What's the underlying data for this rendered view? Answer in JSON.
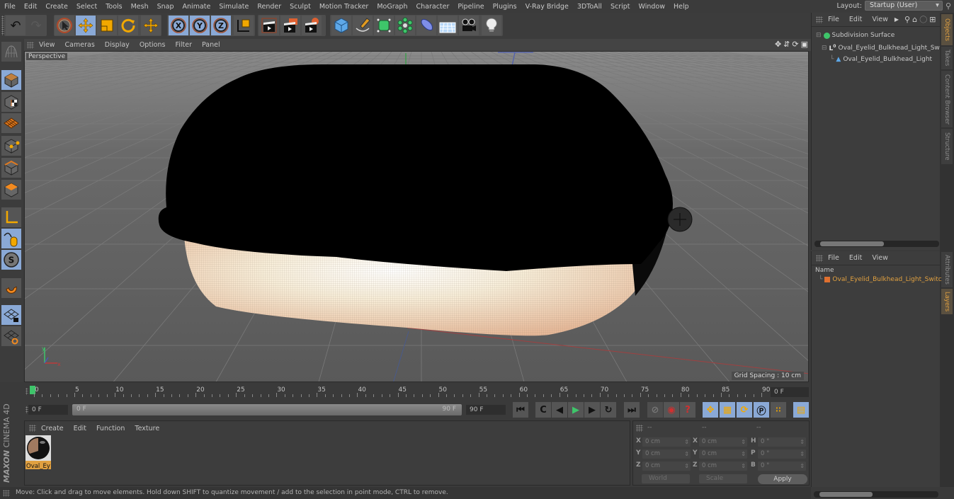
{
  "app": {
    "name": "CINEMA 4D",
    "brand": "MAXON"
  },
  "menubar": {
    "items": [
      "File",
      "Edit",
      "Create",
      "Select",
      "Tools",
      "Mesh",
      "Snap",
      "Animate",
      "Simulate",
      "Render",
      "Sculpt",
      "Motion Tracker",
      "MoGraph",
      "Character",
      "Pipeline",
      "Plugins",
      "V-Ray Bridge",
      "3DToAll",
      "Script",
      "Window",
      "Help"
    ],
    "layout_label": "Layout:",
    "layout_value": "Startup (User)"
  },
  "toolbar": {
    "buttons": [
      {
        "name": "undo-icon",
        "active": false
      },
      {
        "name": "redo-icon",
        "active": false
      },
      {
        "name": "live-selection-icon",
        "active": false
      },
      {
        "name": "move-icon",
        "active": true
      },
      {
        "name": "scale-icon",
        "active": false
      },
      {
        "name": "rotate-icon",
        "active": false
      },
      {
        "name": "recent-tool-icon",
        "active": false
      },
      {
        "name": "x-axis-lock-icon",
        "active": true,
        "label": "X"
      },
      {
        "name": "y-axis-lock-icon",
        "active": true,
        "label": "Y"
      },
      {
        "name": "z-axis-lock-icon",
        "active": true,
        "label": "Z"
      },
      {
        "name": "coordinate-system-icon",
        "active": false
      },
      {
        "name": "render-view-icon",
        "active": false
      },
      {
        "name": "render-picture-viewer-icon",
        "active": false
      },
      {
        "name": "render-settings-icon",
        "active": false
      },
      {
        "name": "cube-icon",
        "active": false
      },
      {
        "name": "pen-icon",
        "active": false
      },
      {
        "name": "subdivision-surface-icon",
        "active": false
      },
      {
        "name": "cloner-icon",
        "active": false
      },
      {
        "name": "deformer-icon",
        "active": false
      },
      {
        "name": "floor-icon",
        "active": false
      },
      {
        "name": "camera-icon",
        "active": false
      },
      {
        "name": "light-icon",
        "active": false
      }
    ]
  },
  "left_tools": [
    {
      "name": "make-editable-icon",
      "active": false
    },
    {
      "name": "model-mode-icon",
      "active": true
    },
    {
      "name": "texture-mode-icon",
      "active": false
    },
    {
      "name": "workplane-mode-icon",
      "active": false
    },
    {
      "name": "points-mode-icon",
      "active": false
    },
    {
      "name": "edges-mode-icon",
      "active": false
    },
    {
      "name": "polygons-mode-icon",
      "active": false
    },
    {
      "name": "axis-mode-icon",
      "active": false
    },
    {
      "name": "tweak-mode-icon",
      "active": true
    },
    {
      "name": "solo-mode-icon",
      "active": true
    },
    {
      "name": "snap-icon",
      "active": false
    },
    {
      "name": "workplane-lock-icon",
      "active": true
    },
    {
      "name": "planar-workplane-icon",
      "active": false
    }
  ],
  "viewport": {
    "menu": [
      "View",
      "Cameras",
      "Display",
      "Options",
      "Filter",
      "Panel"
    ],
    "label": "Perspective",
    "grid_spacing": "Grid Spacing : 10 cm",
    "nav_icons": [
      "move-view-icon",
      "dolly-icon",
      "rotate-view-icon",
      "maximize-icon"
    ]
  },
  "object_manager": {
    "menu": [
      "File",
      "Edit",
      "View"
    ],
    "items": [
      {
        "label": "Subdivision Surface",
        "icon": "subdivision-icon",
        "indent": 0
      },
      {
        "label": "Oval_Eyelid_Bulkhead_Light_Swit",
        "icon": "null-object-icon",
        "indent": 1
      },
      {
        "label": "Oval_Eyelid_Bulkhead_Light",
        "icon": "polygon-object-icon",
        "indent": 2
      }
    ]
  },
  "right_tabs": [
    {
      "label": "Objects",
      "active": true
    },
    {
      "label": "Takes",
      "active": false
    },
    {
      "label": "Content Browser",
      "active": false
    },
    {
      "label": "Structure",
      "active": false
    },
    {
      "label": "Attributes",
      "active": false
    },
    {
      "label": "Layers",
      "active": true
    }
  ],
  "layer_manager": {
    "menu": [
      "File",
      "Edit",
      "View"
    ],
    "column_header": "Name",
    "items": [
      {
        "label": "Oval_Eyelid_Bulkhead_Light_Switc",
        "color": "#e07030"
      }
    ]
  },
  "timeline": {
    "ticks": [
      "0",
      "5",
      "10",
      "15",
      "20",
      "25",
      "30",
      "35",
      "40",
      "45",
      "50",
      "55",
      "60",
      "65",
      "70",
      "75",
      "80",
      "85",
      "90"
    ],
    "current_frame": "0 F",
    "start_field": "0 F",
    "range_start": "0 F",
    "range_end": "90 F",
    "end_field": "90 F"
  },
  "transport": {
    "buttons": [
      "go-to-start-icon",
      "previous-key-icon",
      "previous-frame-icon",
      "play-icon",
      "next-frame-icon",
      "next-key-icon",
      "go-to-end-icon",
      "record-off-icon",
      "autokey-icon",
      "keyframe-selection-icon",
      "position-key-icon",
      "scale-key-icon",
      "rotation-key-icon",
      "parameter-key-icon",
      "point-level-animation-icon",
      "timeline-icon"
    ]
  },
  "material_manager": {
    "menu": [
      "Create",
      "Edit",
      "Function",
      "Texture"
    ],
    "materials": [
      {
        "label": "Oval_Ey"
      }
    ]
  },
  "coordinates": {
    "headers": [
      "--",
      "--",
      "--"
    ],
    "rows": [
      {
        "l1": "X",
        "v1": "0 cm",
        "l2": "X",
        "v2": "0 cm",
        "l3": "H",
        "v3": "0 °"
      },
      {
        "l1": "Y",
        "v1": "0 cm",
        "l2": "Y",
        "v2": "0 cm",
        "l3": "P",
        "v3": "0 °"
      },
      {
        "l1": "Z",
        "v1": "0 cm",
        "l2": "Z",
        "v2": "0 cm",
        "l3": "B",
        "v3": "0 °"
      }
    ],
    "mode_dropdown": "World",
    "scale_dropdown": "Scale",
    "apply_label": "Apply"
  },
  "status_bar": "Move: Click and drag to move elements. Hold down SHIFT to quantize movement / add to the selection in point mode, CTRL to remove.",
  "colors": {
    "accent": "#8aa9d6",
    "highlight": "#e0a040",
    "play": "#3ec56a"
  }
}
